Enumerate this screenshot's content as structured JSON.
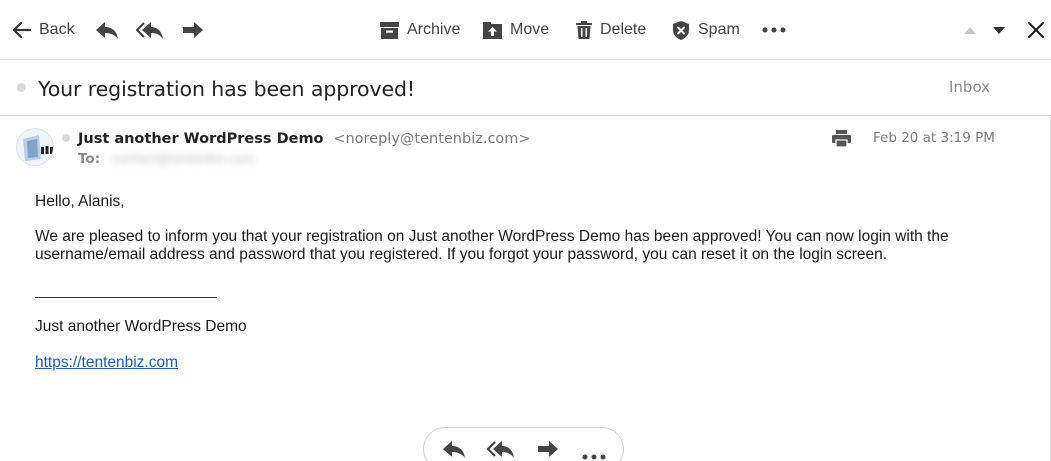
{
  "toolbar": {
    "back_label": "Back",
    "archive_label": "Archive",
    "move_label": "Move",
    "delete_label": "Delete",
    "spam_label": "Spam"
  },
  "subject": {
    "title": "Your registration has been approved!",
    "folder": "Inbox"
  },
  "message": {
    "sender_name": "Just another WordPress Demo",
    "sender_email": "<noreply@tentenbiz.com>",
    "to_label": "To:",
    "to_value": "contact@tentenbiz.com",
    "date": "Feb 20 at 3:19 PM",
    "greeting": "Hello, Alanis,",
    "paragraph": "We are pleased to inform you that your registration on Just another WordPress Demo has been approved! You can now login with the username/email address and password that you registered. If you forgot your password, you can reset it on the login screen.",
    "signature_name": "Just another WordPress Demo",
    "signature_link": "https://tentenbiz.com"
  },
  "icons": {
    "back": "arrow-left-icon",
    "reply": "reply-icon",
    "reply_all": "reply-all-icon",
    "forward": "forward-icon",
    "archive": "archive-icon",
    "move": "move-icon",
    "delete": "trash-icon",
    "spam": "shield-icon",
    "more": "more-icon",
    "prev": "triangle-up-icon",
    "next": "triangle-down-icon",
    "close": "close-icon",
    "print": "printer-icon"
  },
  "colors": {
    "link": "#1a5dbf",
    "icon": "#444444",
    "muted": "#8a8a8a"
  }
}
